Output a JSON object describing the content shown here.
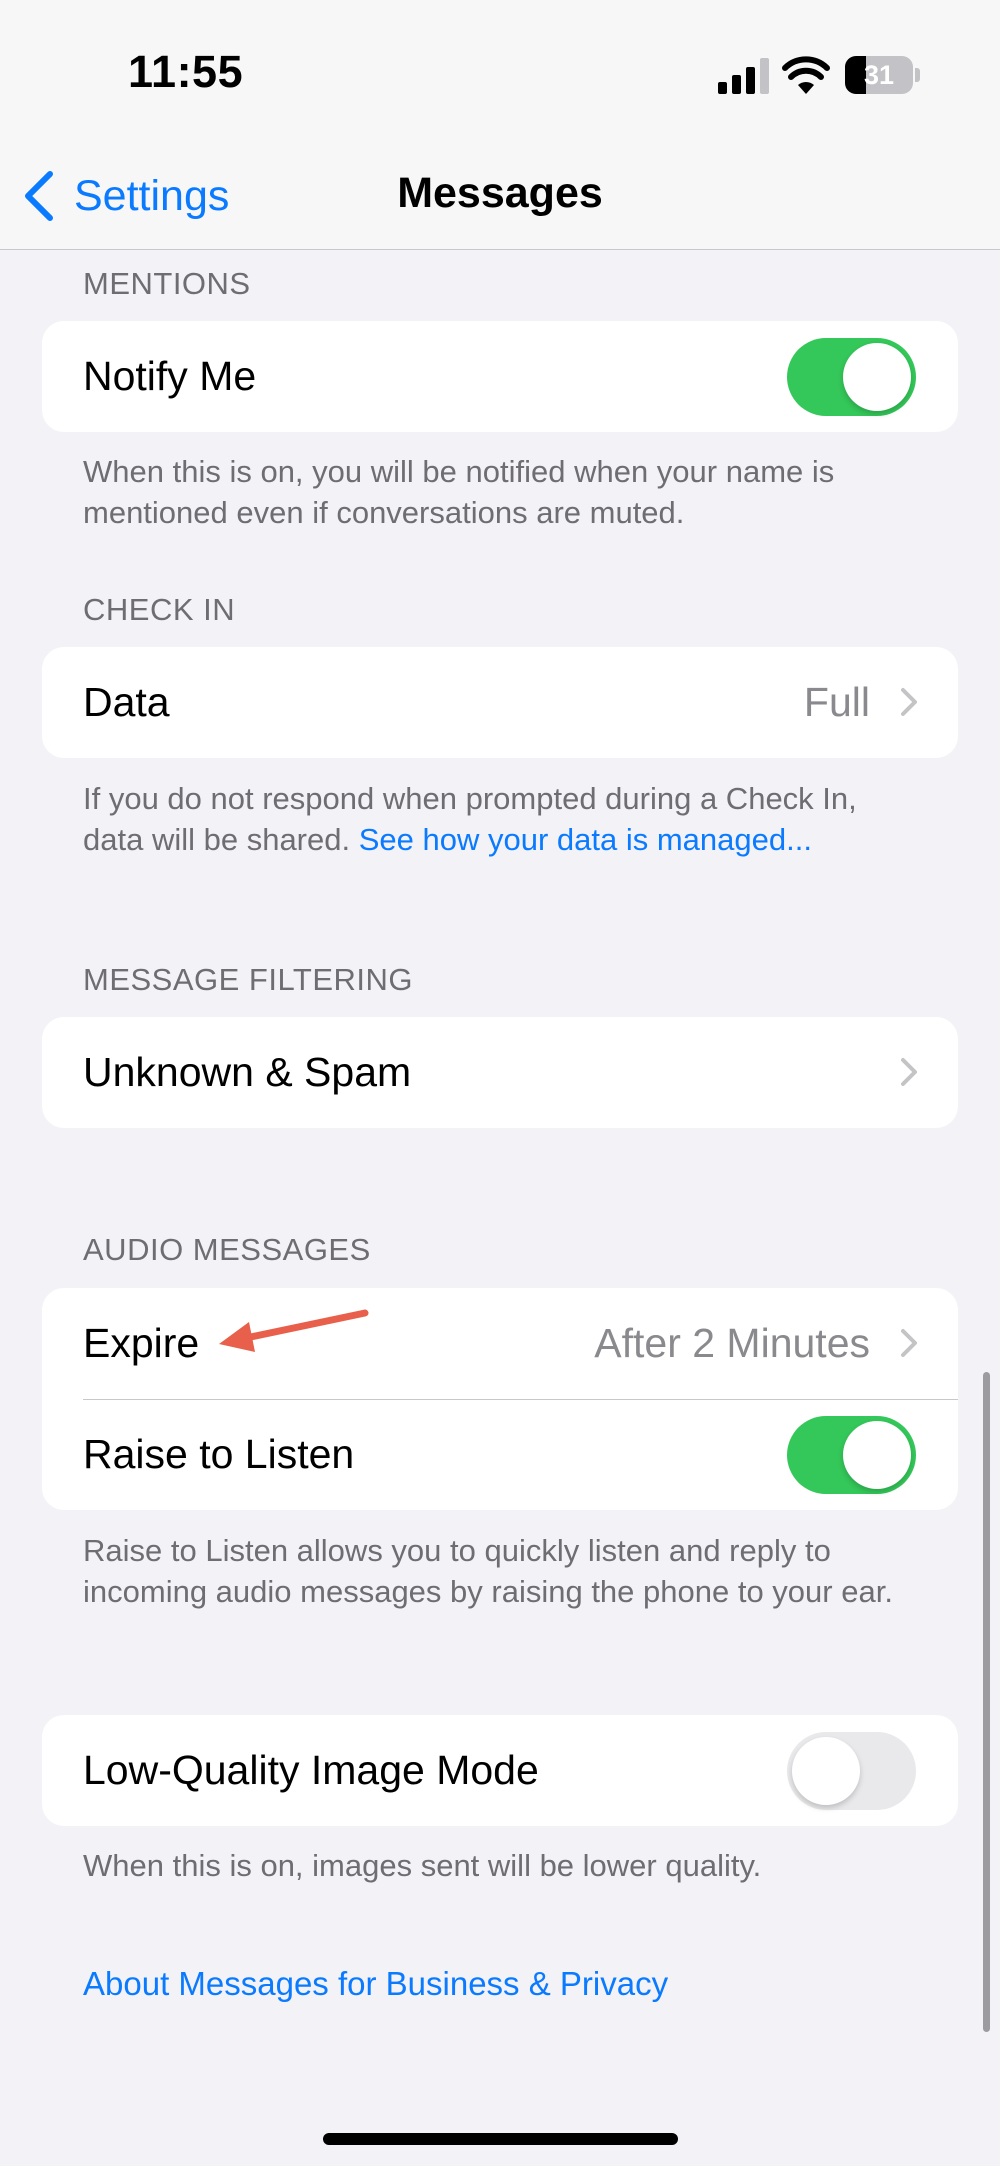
{
  "status_bar": {
    "time": "11:55",
    "battery_level": "31",
    "battery_fraction": 0.31
  },
  "nav": {
    "back_label": "Settings",
    "title": "Messages"
  },
  "sections": {
    "mentions": {
      "header": "MENTIONS",
      "notify_me_label": "Notify Me",
      "notify_me_on": true,
      "footer": "When this is on, you will be notified when your name is mentioned even if conversations are muted."
    },
    "check_in": {
      "header": "CHECK IN",
      "data_label": "Data",
      "data_value": "Full",
      "footer_text": "If you do not respond when prompted during a Check In, data will be shared.",
      "footer_link": "See how your data is managed..."
    },
    "message_filtering": {
      "header": "MESSAGE FILTERING",
      "unknown_spam_label": "Unknown & Spam"
    },
    "audio_messages": {
      "header": "AUDIO MESSAGES",
      "expire_label": "Expire",
      "expire_value": "After 2 Minutes",
      "raise_to_listen_label": "Raise to Listen",
      "raise_to_listen_on": true,
      "footer": "Raise to Listen allows you to quickly listen and reply to incoming audio messages by raising the phone to your ear."
    },
    "image_mode": {
      "low_quality_label": "Low-Quality Image Mode",
      "low_quality_on": false,
      "footer": "When this is on, images sent will be lower quality."
    }
  },
  "about_link": "About Messages for Business & Privacy",
  "colors": {
    "accent": "#0a7aff",
    "toggle_on": "#34c759",
    "toggle_off": "#e9e9eb",
    "annotation_arrow": "#e8604c"
  }
}
